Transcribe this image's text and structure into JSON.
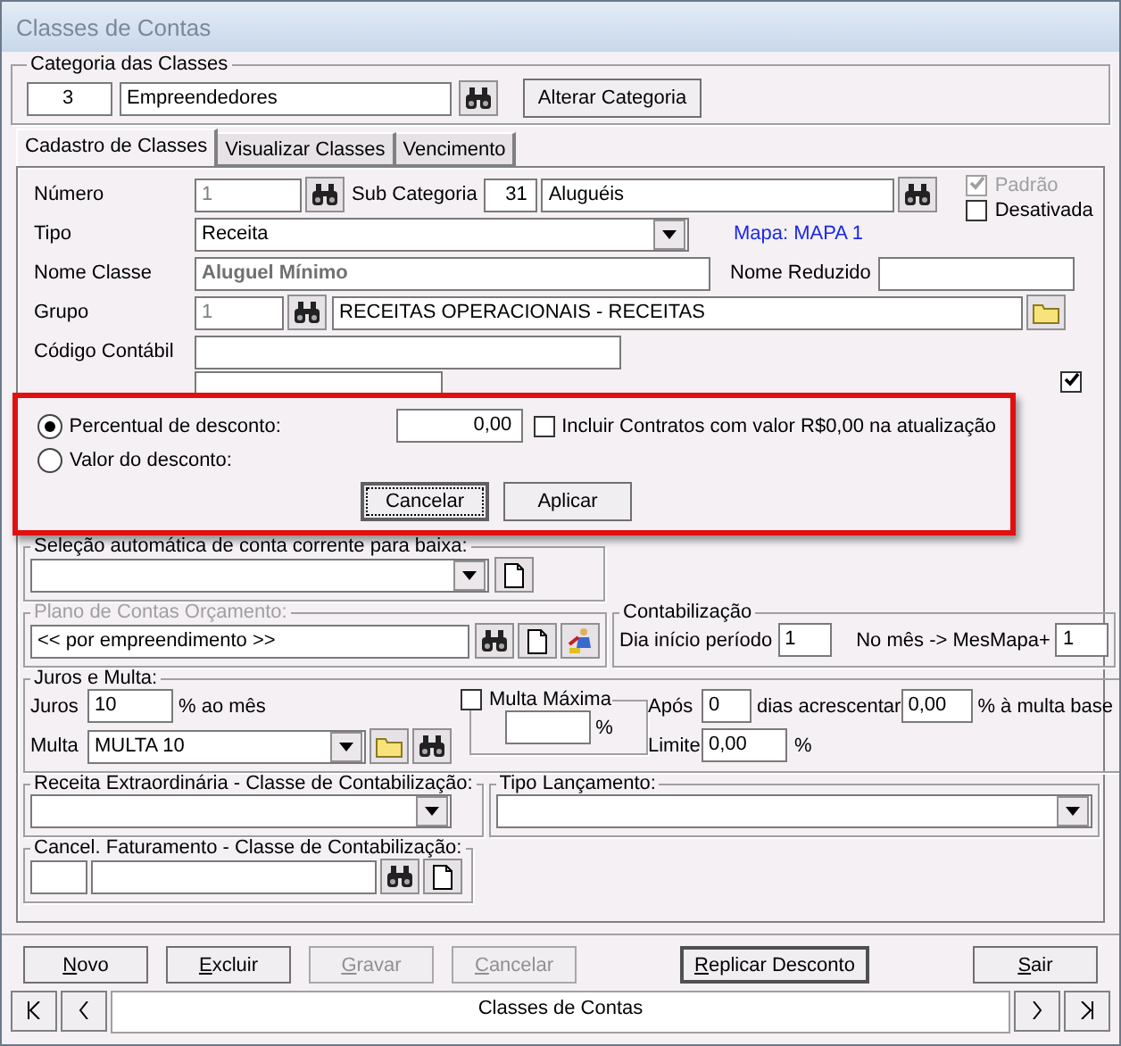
{
  "window": {
    "title": "Classes de Contas"
  },
  "categoria": {
    "legend": "Categoria das Classes",
    "code": "3",
    "name": "Empreendedores",
    "button": "Alterar Categoria"
  },
  "tabs": [
    {
      "label": "Cadastro de Classes",
      "selected": true
    },
    {
      "label": "Visualizar Classes",
      "selected": false
    },
    {
      "label": "Vencimento",
      "selected": false
    }
  ],
  "form": {
    "numero": {
      "label": "Número",
      "value": "1"
    },
    "sub_categoria": {
      "label": "Sub Categoria",
      "code": "31",
      "name": "Aluguéis"
    },
    "padrao": {
      "label": "Padrão",
      "checked": true,
      "disabled": true
    },
    "desativada": {
      "label": "Desativada",
      "checked": false,
      "disabled": false
    },
    "tipo": {
      "label": "Tipo",
      "value": "Receita"
    },
    "mapa": "Mapa: MAPA 1",
    "nome_classe": {
      "label": "Nome Classe",
      "value": "Aluguel Mínimo"
    },
    "nome_reduzido": {
      "label": "Nome Reduzido"
    },
    "grupo": {
      "label": "Grupo",
      "code": "1",
      "name": "RECEITAS OPERACIONAIS - RECEITAS"
    },
    "codigo_contabil": {
      "label": "Código Contábil"
    },
    "partly_hidden_row": {
      "checked": true
    }
  },
  "discount_dialog": {
    "options": [
      {
        "label": "Percentual de desconto:",
        "selected": true
      },
      {
        "label": "Valor do desconto:",
        "selected": false
      }
    ],
    "value": "0,00",
    "include": {
      "label": "Incluir Contratos com valor R$0,00 na atualização",
      "checked": false
    },
    "buttons": [
      {
        "label": "Cancelar",
        "focused": true
      },
      {
        "label": "Aplicar",
        "focused": false
      }
    ]
  },
  "selecao": {
    "legend": "Seleção automática de conta corrente para baixa:"
  },
  "plano": {
    "legend": "Plano de Contas Orçamento:",
    "value": "<< por empreendimento >>",
    "disabled": true
  },
  "contabilizacao": {
    "legend": "Contabilização",
    "dia_label": "Dia início período",
    "dia": "1",
    "mes_label": "No mês -> MesMapa+",
    "mes": "1"
  },
  "juros": {
    "legend": "Juros e Multa:",
    "juros_label": "Juros",
    "juros": "10",
    "juros_unit": "% ao mês",
    "multa_label": "Multa",
    "multa": "MULTA 10",
    "multa_maxima": {
      "label": "Multa Máxima",
      "checked": false
    },
    "max_unit": "%",
    "apos_label": "Após",
    "apos": "0",
    "dias_label": "dias acrescentar",
    "acrescentar": "0,00",
    "base_label": "% à multa base",
    "limite_label": "Limite",
    "limite": "0,00",
    "limite_unit": "%"
  },
  "receita_extra": {
    "legend": "Receita Extraordinária - Classe de Contabilização:"
  },
  "tipo_lancamento": {
    "legend": "Tipo Lançamento:"
  },
  "cancel_fat": {
    "legend": "Cancel. Faturamento - Classe de Contabilização:"
  },
  "buttons": [
    {
      "label": "Novo",
      "disabled": false,
      "default": false
    },
    {
      "label": "Excluir",
      "disabled": false,
      "default": false
    },
    {
      "label": "Gravar",
      "disabled": true,
      "default": false
    },
    {
      "label": "Cancelar",
      "disabled": true,
      "default": false
    },
    {
      "label": "Replicar Desconto",
      "disabled": false,
      "default": true
    },
    {
      "label": "Sair",
      "disabled": false,
      "default": false
    }
  ],
  "navigator": {
    "caption": "Classes de Contas"
  }
}
